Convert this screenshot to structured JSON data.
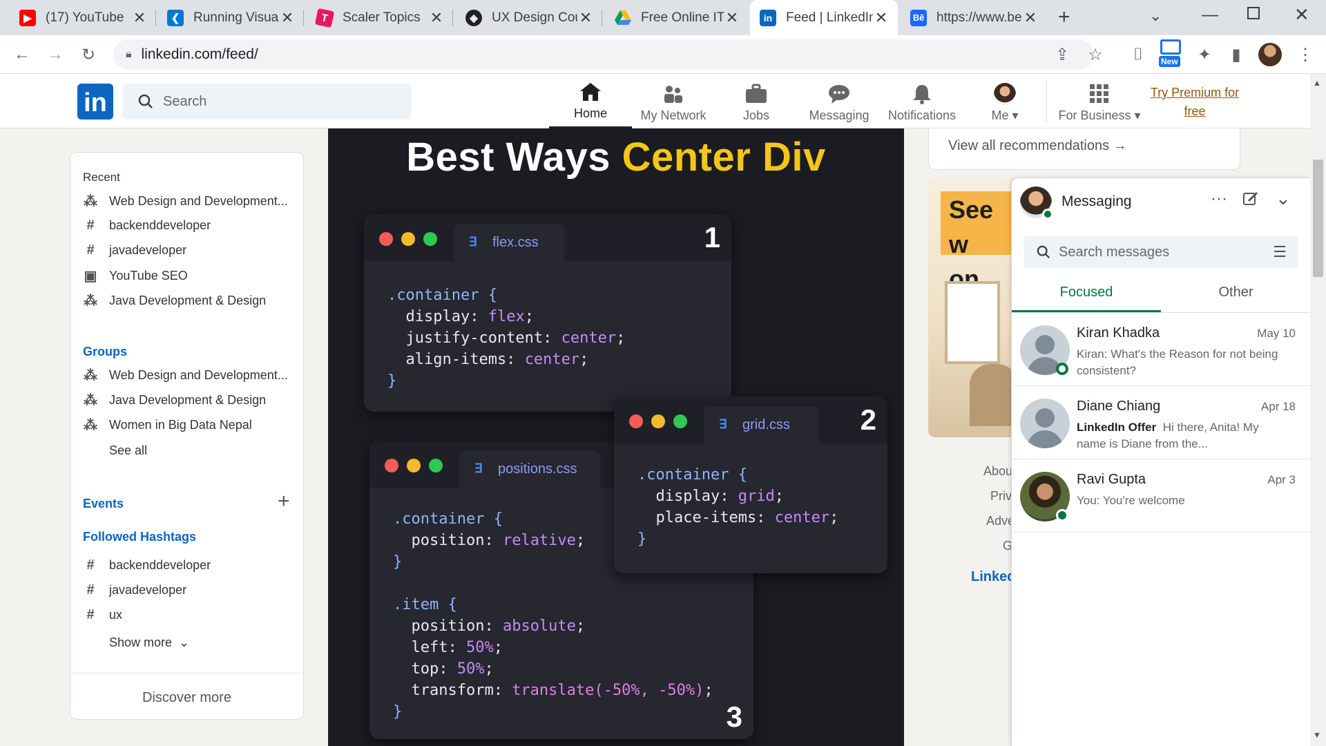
{
  "browser": {
    "tabs": [
      {
        "title": "(17) YouTube",
        "icon": "youtube-icon"
      },
      {
        "title": "Running Visual",
        "icon": "vscode-icon"
      },
      {
        "title": "Scaler Topics",
        "icon": "scaler-icon"
      },
      {
        "title": "UX Design Cou",
        "icon": "ux-icon"
      },
      {
        "title": "Free Online IT",
        "icon": "drive-icon"
      },
      {
        "title": "Feed | LinkedIn",
        "icon": "linkedin-icon"
      },
      {
        "title": "https://www.be",
        "icon": "behance-icon"
      }
    ],
    "new_tab_label": "+",
    "url": "linkedin.com/feed/",
    "new_badge": "New"
  },
  "header": {
    "logo": "in",
    "search_placeholder": "Search",
    "nav": [
      {
        "label": "Home",
        "icon": "home-icon"
      },
      {
        "label": "My Network",
        "icon": "network-icon"
      },
      {
        "label": "Jobs",
        "icon": "briefcase-icon"
      },
      {
        "label": "Messaging",
        "icon": "messaging-icon"
      },
      {
        "label": "Notifications",
        "icon": "bell-icon"
      },
      {
        "label": "Me",
        "icon": "avatar"
      },
      {
        "label": "For Business",
        "icon": "grid-icon"
      }
    ],
    "premium": [
      "Try Premium for",
      "free"
    ]
  },
  "sidebar": {
    "recent_heading": "Recent",
    "recent": [
      {
        "label": "Web Design and Development...",
        "icon": "group-icon"
      },
      {
        "label": "backenddeveloper",
        "icon": "hashtag-icon"
      },
      {
        "label": "javadeveloper",
        "icon": "hashtag-icon"
      },
      {
        "label": "YouTube SEO",
        "icon": "calendar-icon"
      },
      {
        "label": "Java Development & Design",
        "icon": "group-icon"
      }
    ],
    "groups_heading": "Groups",
    "groups": [
      {
        "label": "Web Design and Development..."
      },
      {
        "label": "Java Development & Design"
      },
      {
        "label": "Women in Big Data Nepal"
      }
    ],
    "see_all": "See all",
    "events_heading": "Events",
    "hashtags_heading": "Followed Hashtags",
    "hashtags": [
      "backenddeveloper",
      "javadeveloper",
      "ux"
    ],
    "show_more": "Show more",
    "discover_more": "Discover more"
  },
  "post": {
    "title_white": "Best Ways",
    "title_yellow": "Center Div",
    "windows": [
      {
        "file": "flex.css",
        "number": "1"
      },
      {
        "file": "grid.css",
        "number": "2"
      },
      {
        "file": "positions.css",
        "number": "3"
      }
    ],
    "code": {
      "flex": [
        ".container {",
        "  display: ",
        "flex",
        ";",
        "  justify-content: ",
        "center",
        ";",
        "  align-items: ",
        "center",
        ";",
        "}"
      ],
      "grid": [
        ".container {",
        "  display: ",
        "grid",
        ";",
        "  place-items: ",
        "center",
        ";",
        "}"
      ],
      "pos": [
        ".container {",
        "  position: ",
        "relative",
        ";",
        "}",
        ".item {",
        "  position: ",
        "absolute",
        ";",
        "  left: ",
        "50%",
        ";",
        "  top: ",
        "50%",
        ";",
        "  transform: ",
        "translate(-50%, -50%)",
        ";",
        "}"
      ]
    }
  },
  "right_rail": {
    "view_all": "View all recommendations",
    "ad_text": [
      "See w",
      "on Lin"
    ],
    "footer_partial": [
      "Abou",
      "Priv",
      "Adve",
      "G"
    ],
    "linkedin_partial": "Linked"
  },
  "messaging": {
    "title": "Messaging",
    "search_placeholder": "Search messages",
    "tabs": [
      "Focused",
      "Other"
    ],
    "conversations": [
      {
        "name": "Kiran Khadka",
        "date": "May 10",
        "preview": "Kiran: What's the Reason for not being consistent?"
      },
      {
        "name": "Diane Chiang",
        "date": "Apr 18",
        "offer": "LinkedIn Offer",
        "preview": "Hi there, Anita! My name is Diane from the..."
      },
      {
        "name": "Ravi Gupta",
        "date": "Apr 3",
        "preview": "You: You're welcome"
      }
    ]
  },
  "colors": {
    "linkedin_blue": "#0a66c2",
    "online_green": "#057642",
    "post_bg": "#1b1c22",
    "title_yellow": "#f5c518"
  }
}
